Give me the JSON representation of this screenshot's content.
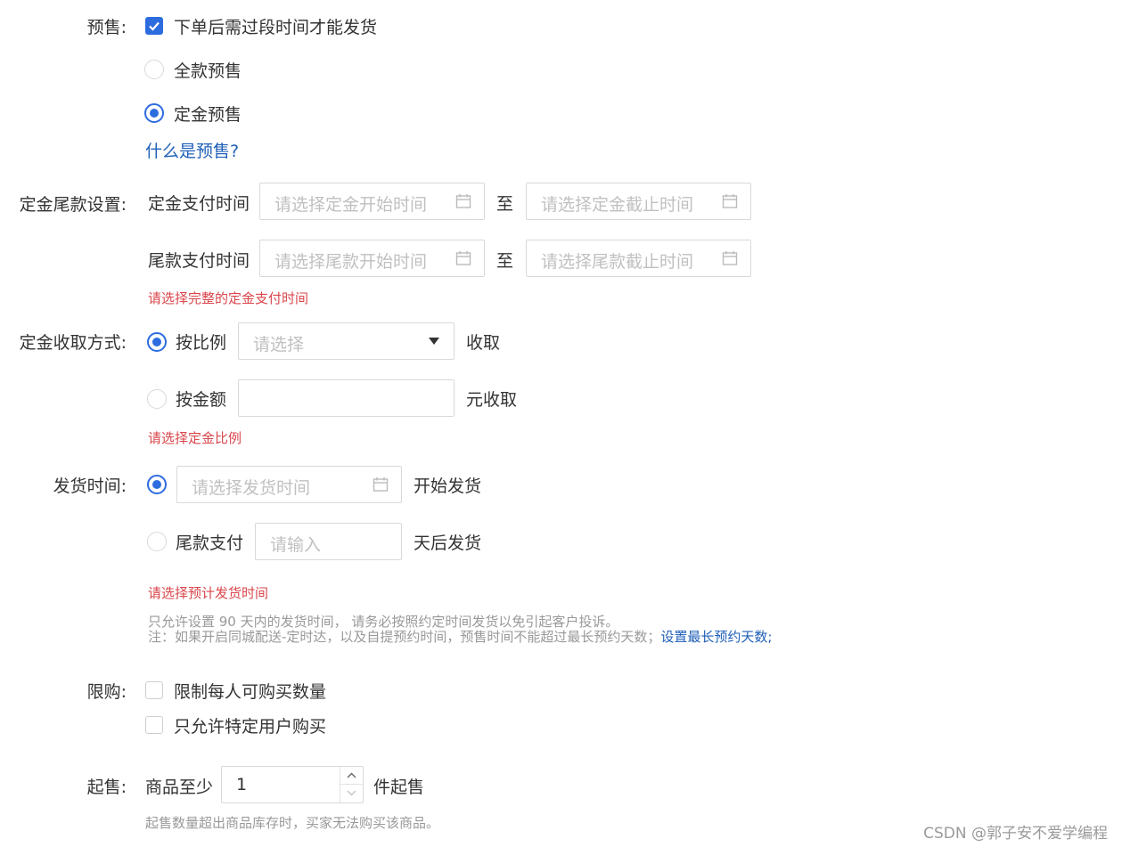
{
  "presale": {
    "label": "预售:",
    "checkbox_label": "下单后需过段时间才能发货",
    "option_full": "全款预售",
    "option_deposit": "定金预售",
    "help_link": "什么是预售?"
  },
  "deposit_settings": {
    "label": "定金尾款设置:",
    "deposit_time_label": "定金支付时间",
    "deposit_start_placeholder": "请选择定金开始时间",
    "deposit_end_placeholder": "请选择定金截止时间",
    "balance_time_label": "尾款支付时间",
    "balance_start_placeholder": "请选择尾款开始时间",
    "balance_end_placeholder": "请选择尾款截止时间",
    "to": "至",
    "error": "请选择完整的定金支付时间"
  },
  "deposit_method": {
    "label": "定金收取方式:",
    "by_ratio": "按比例",
    "ratio_placeholder": "请选择",
    "ratio_suffix": "收取",
    "by_amount": "按金额",
    "amount_suffix": "元收取",
    "error": "请选择定金比例"
  },
  "ship_time": {
    "label": "发货时间:",
    "date_placeholder": "请选择发货时间",
    "date_suffix": "开始发货",
    "after_balance": "尾款支付",
    "days_placeholder": "请输入",
    "days_suffix": "天后发货",
    "error": "请选择预计发货时间",
    "note1": "只允许设置 90 天内的发货时间， 请务必按照约定时间发货以免引起客户投诉。",
    "note2": "注：如果开启同城配送-定时达，以及自提预约时间，预售时间不能超过最长预约天数；",
    "note2_link": "设置最长预约天数;"
  },
  "limit": {
    "label": "限购:",
    "per_person": "限制每人可购买数量",
    "specific_users": "只允许特定用户购买"
  },
  "min_sale": {
    "label": "起售:",
    "prefix": "商品至少",
    "value": "1",
    "suffix": "件起售",
    "note": "起售数量超出商品库存时，买家无法购买该商品。"
  },
  "watermark": "CSDN @郭子安不爱学编程",
  "colors": {
    "accent": "#2d6cdf",
    "error": "#d9464b",
    "link": "#1f5fb8"
  }
}
